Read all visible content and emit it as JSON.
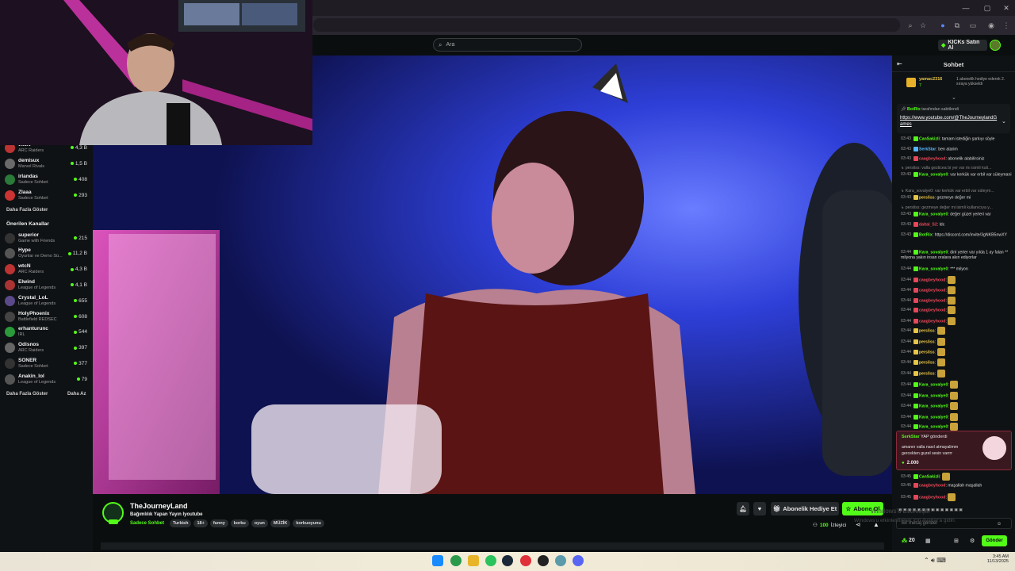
{
  "browser": {
    "window_controls": [
      "—",
      "▢",
      "✕"
    ]
  },
  "header": {
    "search_placeholder": "Ara",
    "kicks_label": "KICKs Satın Al"
  },
  "sidebar": {
    "top_channels": [
      {
        "name": "wtcN",
        "sub": "ARC Raiders",
        "count": "4,3 B",
        "color": "#b33"
      },
      {
        "name": "demisux",
        "sub": "Marvel Rivals",
        "count": "1,5 B",
        "color": "#6a6a6a"
      },
      {
        "name": "irlandas",
        "sub": "Sadece Sohbet",
        "count": "408",
        "color": "#2a7a3a"
      },
      {
        "name": "Zlaaa",
        "sub": "Sadece Sohbet",
        "count": "293",
        "color": "#c33"
      }
    ],
    "show_more_1": "Daha Fazla Göster",
    "recommended_title": "Önerilen Kanallar",
    "recommended": [
      {
        "name": "superior",
        "sub": "Game with Friends",
        "count": "215",
        "color": "#333"
      },
      {
        "name": "Hype",
        "sub": "Oyunlar ve Demo Sü...",
        "count": "11,2 B",
        "color": "#555"
      },
      {
        "name": "wtcN",
        "sub": "ARC Raiders",
        "count": "4,3 B",
        "color": "#b33"
      },
      {
        "name": "Elwind",
        "sub": "League of Legends",
        "count": "4,1 B",
        "color": "#a33"
      },
      {
        "name": "Crystal_LoL",
        "sub": "League of Legends",
        "count": "655",
        "color": "#5a4a8a"
      },
      {
        "name": "HolyPhoenix",
        "sub": "Battlefield REDSEC",
        "count": "608",
        "color": "#444"
      },
      {
        "name": "erhanturunc",
        "sub": "IRL",
        "count": "544",
        "color": "#2a9a3a"
      },
      {
        "name": "Odisnos",
        "sub": "ARC Raiders",
        "count": "397",
        "color": "#666"
      },
      {
        "name": "SONER",
        "sub": "Sadece Sohbet",
        "count": "377",
        "color": "#333"
      },
      {
        "name": "Anakin_lol",
        "sub": "League of Legends",
        "count": "79",
        "color": "#555"
      }
    ],
    "show_more_2": "Daha Fazla Göster",
    "show_less": "Daha Az"
  },
  "channel": {
    "name": "TheJourneyLand",
    "title": "Bağımlılık Yapan Yayın Iyoutube",
    "category": "Sadece Sohbet",
    "tags": [
      "Turkish",
      "18+",
      "funny",
      "korku",
      "oyun",
      "MÜZİK",
      "korkuoyunu"
    ],
    "viewers_count": "100",
    "viewers_label": "İzleyici",
    "gift_label": "Abonelik Hediye Et",
    "subscribe_label": "Abone Ol"
  },
  "chat": {
    "title": "Sohbet",
    "gifter": {
      "name": "yamac2316",
      "count": "7",
      "text": "1 abonelik hediye ederek 2. sıraya yükseldi"
    },
    "pinned": {
      "by": "BotRix",
      "by_suffix": "tarafından sabitlendi",
      "link": "https://www.youtube.com/@TheJourneylandGames"
    },
    "messages": [
      {
        "t": "03:43",
        "u": "CanSakizli",
        "c": "#53fc18",
        "m": "tamam istediğin şarkıyı söyle"
      },
      {
        "t": "03:43",
        "u": "SerkStar",
        "c": "#58b6ff",
        "m": "ben atarim"
      },
      {
        "t": "03:43",
        "u": "caagbeyhood",
        "c": "#e8475a",
        "m": "abonelik alabilirsiniz"
      },
      {
        "t": "",
        "u": "",
        "c": "#888",
        "m": "↳ persliss: valla gezticea bi yer var mı isimli kuti..."
      },
      {
        "t": "03:43",
        "u": "Kara_sovalye0",
        "c": "#53fc18",
        "m": "var kerkük var erbil var süleymani duhok"
      },
      {
        "t": "",
        "u": "",
        "c": "#888",
        "m": "↳ Kara_sovalye0: var kerkük var erbil var süleym..."
      },
      {
        "t": "03:43",
        "u": "persliss",
        "c": "#e8c547",
        "m": "gezmeye değer mi"
      },
      {
        "t": "",
        "u": "",
        "c": "#888",
        "m": "↳ persliss: gezmeye değer mi isimli kullanıcıya y..."
      },
      {
        "t": "03:43",
        "u": "Kara_sovalye0",
        "c": "#53fc18",
        "m": "değer güzel yerleri var"
      },
      {
        "t": "03:43",
        "u": "daltal_S2",
        "c": "#e8475a",
        "m": "ldc"
      },
      {
        "t": "03:43",
        "u": "BotRix",
        "c": "#53fc18",
        "m": "https://discord.com/invite/3gNKB5nwXY"
      },
      {
        "t": "03:44",
        "u": "Kara_sovalye0",
        "c": "#53fc18",
        "m": "dinl yerler var yılda 1 ay falan ** milyona yakın insan oralara akın ediyorlar"
      },
      {
        "t": "03:44",
        "u": "Kara_sovalye0",
        "c": "#53fc18",
        "m": "*** milyon"
      },
      {
        "t": "03:44",
        "u": "caagbeyhood",
        "c": "#e8475a",
        "m": "emo"
      },
      {
        "t": "03:44",
        "u": "caagbeyhood",
        "c": "#e8475a",
        "m": "emo"
      },
      {
        "t": "03:44",
        "u": "caagbeyhood",
        "c": "#e8475a",
        "m": "emo"
      },
      {
        "t": "03:44",
        "u": "caagbeyhood",
        "c": "#e8475a",
        "m": "emo"
      },
      {
        "t": "03:44",
        "u": "caagbeyhood",
        "c": "#e8475a",
        "m": "emo"
      },
      {
        "t": "03:44",
        "u": "persliss",
        "c": "#e8c547",
        "m": "emo"
      },
      {
        "t": "03:44",
        "u": "persliss",
        "c": "#e8c547",
        "m": "emo"
      },
      {
        "t": "03:44",
        "u": "persliss",
        "c": "#e8c547",
        "m": "emo"
      },
      {
        "t": "03:44",
        "u": "persliss",
        "c": "#e8c547",
        "m": "emo"
      },
      {
        "t": "03:44",
        "u": "persliss",
        "c": "#e8c547",
        "m": "emo"
      },
      {
        "t": "03:44",
        "u": "Kara_sovalye0",
        "c": "#53fc18",
        "m": "emo"
      },
      {
        "t": "03:44",
        "u": "Kara_sovalye0",
        "c": "#53fc18",
        "m": "emo"
      },
      {
        "t": "03:44",
        "u": "Kara_sovalye0",
        "c": "#53fc18",
        "m": "emo"
      },
      {
        "t": "03:44",
        "u": "Kara_sovalye0",
        "c": "#53fc18",
        "m": "emo"
      },
      {
        "t": "03:44",
        "u": "Kara_sovalye0",
        "c": "#53fc18",
        "m": "emo"
      }
    ],
    "kicks_card": {
      "user": "SerkStar",
      "action": "YAP gönderdi",
      "text": "amanın valla nasıl atmayalimm gercekten guzel sesin varrrr",
      "amount": "2.000"
    },
    "after": [
      {
        "t": "03:45",
        "u": "CanSakizli",
        "c": "#53fc18",
        "m": "emo"
      },
      {
        "t": "03:45",
        "u": "caagbeyhood",
        "c": "#e8475a",
        "m": "maşallah maşallah"
      },
      {
        "t": "03:45",
        "u": "caagbeyhood",
        "c": "#e8475a",
        "m": "emo"
      }
    ],
    "input_placeholder": "Bir mesaj gönder",
    "points": "20",
    "send_label": "Gönder",
    "watermark_line1": "Windows'u Etkinleştir",
    "watermark_line2": "Windows'u etkinleştirmek için Ayarlar'a gidin."
  },
  "taskbar": {
    "time": "3:45 AM",
    "date": "11/13/2025"
  },
  "colors": {
    "accent": "#53fc18",
    "bg": "#0b0e0f",
    "panel": "#0f1214"
  }
}
